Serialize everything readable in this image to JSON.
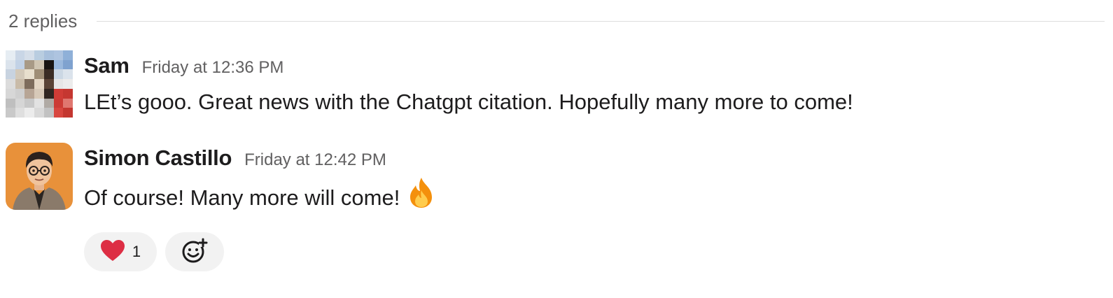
{
  "thread": {
    "reply_count_label": "2 replies"
  },
  "messages": [
    {
      "author": "Sam",
      "timestamp": "Friday at 12:36 PM",
      "text": "LEt’s gooo. Great news with the Chatgpt citation. Hopefully many more to come!",
      "avatar": "pixelated-avatar"
    },
    {
      "author": "Simon Castillo",
      "timestamp": "Friday at 12:42 PM",
      "text": "Of course! Many more will come!",
      "emoji": "fire-emoji",
      "avatar": "illustrated-avatar",
      "reactions": [
        {
          "emoji": "heart-emoji",
          "count": "1"
        }
      ],
      "add_reaction_icon": "add-emoji-icon"
    }
  ],
  "colors": {
    "text_primary": "#1d1c1d",
    "text_secondary": "#616061",
    "divider": "#dddddd",
    "reaction_bg": "#f2f2f2",
    "heart": "#e0245e",
    "avatar_bg": "#e8913a"
  }
}
